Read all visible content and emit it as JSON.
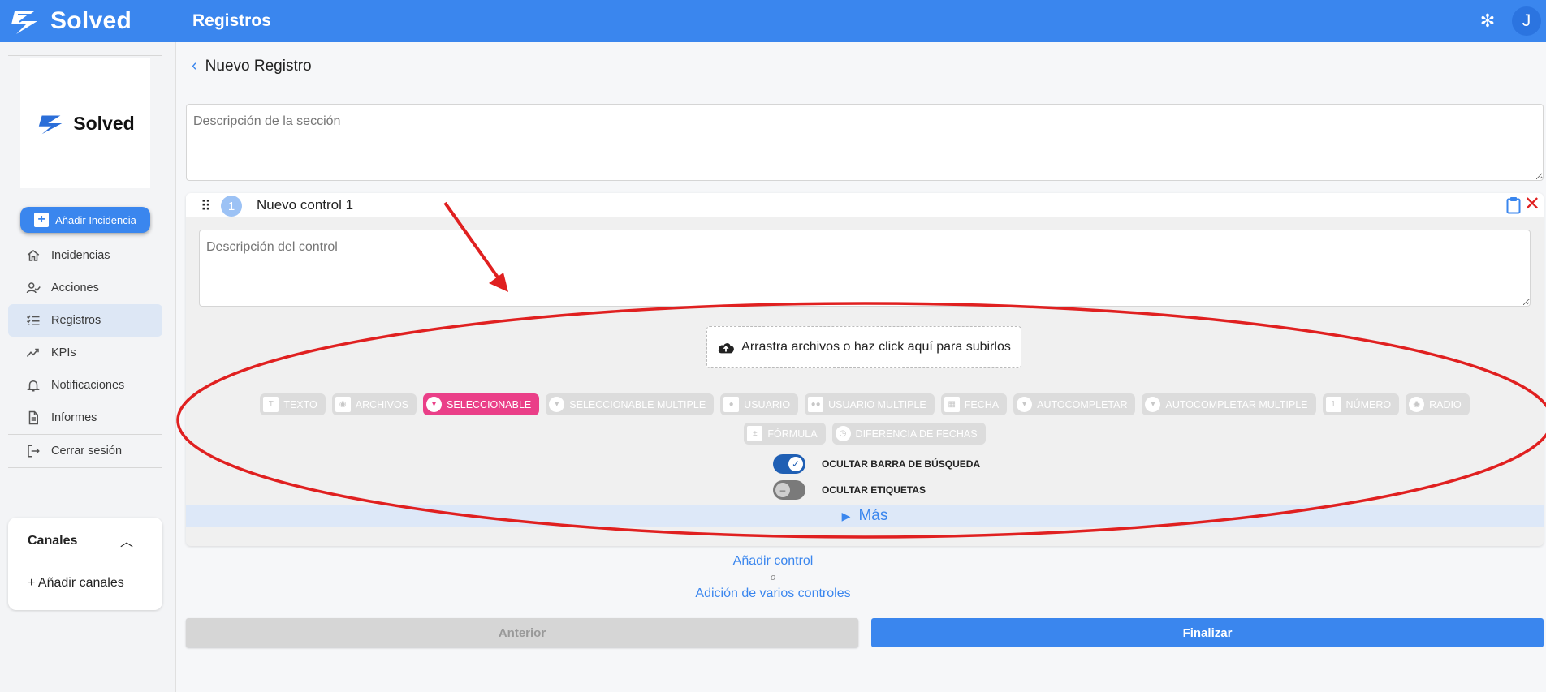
{
  "app": {
    "brand": "Solved",
    "title": "Registros",
    "user_initial": "J"
  },
  "sidebar": {
    "logo_text": "Solved",
    "add_button": "Añadir Incidencia",
    "items": [
      {
        "label": "Incidencias",
        "icon": "home-icon"
      },
      {
        "label": "Acciones",
        "icon": "user-check-icon"
      },
      {
        "label": "Registros",
        "icon": "checklist-icon",
        "active": true
      },
      {
        "label": "KPIs",
        "icon": "trend-icon"
      },
      {
        "label": "Notificaciones",
        "icon": "bell-icon"
      },
      {
        "label": "Informes",
        "icon": "document-icon"
      },
      {
        "label": "Cerrar sesión",
        "icon": "logout-icon"
      }
    ],
    "channels": {
      "title": "Canales",
      "add_label": "+ Añadir canales"
    }
  },
  "main": {
    "page_title": "Nuevo Registro",
    "section_description_placeholder": "Descripción de la sección",
    "control": {
      "number": "1",
      "name": "Nuevo control 1",
      "description_placeholder": "Descripción del control",
      "upload_label": "Arrastra archivos o haz click aquí para subirlos",
      "types": [
        {
          "label": "TEXTO",
          "icon": "text-icon"
        },
        {
          "label": "ARCHIVOS",
          "icon": "camera-icon"
        },
        {
          "label": "SELECCIONABLE",
          "icon": "dropdown-icon",
          "active": true
        },
        {
          "label": "SELECCIONABLE MULTIPLE",
          "icon": "dropdown-icon"
        },
        {
          "label": "USUARIO",
          "icon": "person-icon"
        },
        {
          "label": "USUARIO MULTIPLE",
          "icon": "people-icon"
        },
        {
          "label": "FECHA",
          "icon": "calendar-icon"
        },
        {
          "label": "AUTOCOMPLETAR",
          "icon": "dropdown-icon"
        },
        {
          "label": "AUTOCOMPLETAR MULTIPLE",
          "icon": "dropdown-icon"
        },
        {
          "label": "NÚMERO",
          "icon": "number-icon"
        },
        {
          "label": "RADIO",
          "icon": "radio-icon"
        },
        {
          "label": "FÓRMULA",
          "icon": "formula-icon"
        },
        {
          "label": "DIFERENCIA DE FECHAS",
          "icon": "timer-icon"
        }
      ],
      "toggles": [
        {
          "label": "OCULTAR BARRA DE BÚSQUEDA",
          "on": true
        },
        {
          "label": "OCULTAR ETIQUETAS",
          "on": false
        }
      ],
      "more_label": "Más"
    },
    "add_control": "Añadir control",
    "or_label": "o",
    "add_multiple": "Adición de varios controles",
    "prev_button": "Anterior",
    "finish_button": "Finalizar"
  },
  "colors": {
    "primary": "#3a86ee",
    "active_chip": "#ea3f88",
    "annotation": "#e02020"
  }
}
